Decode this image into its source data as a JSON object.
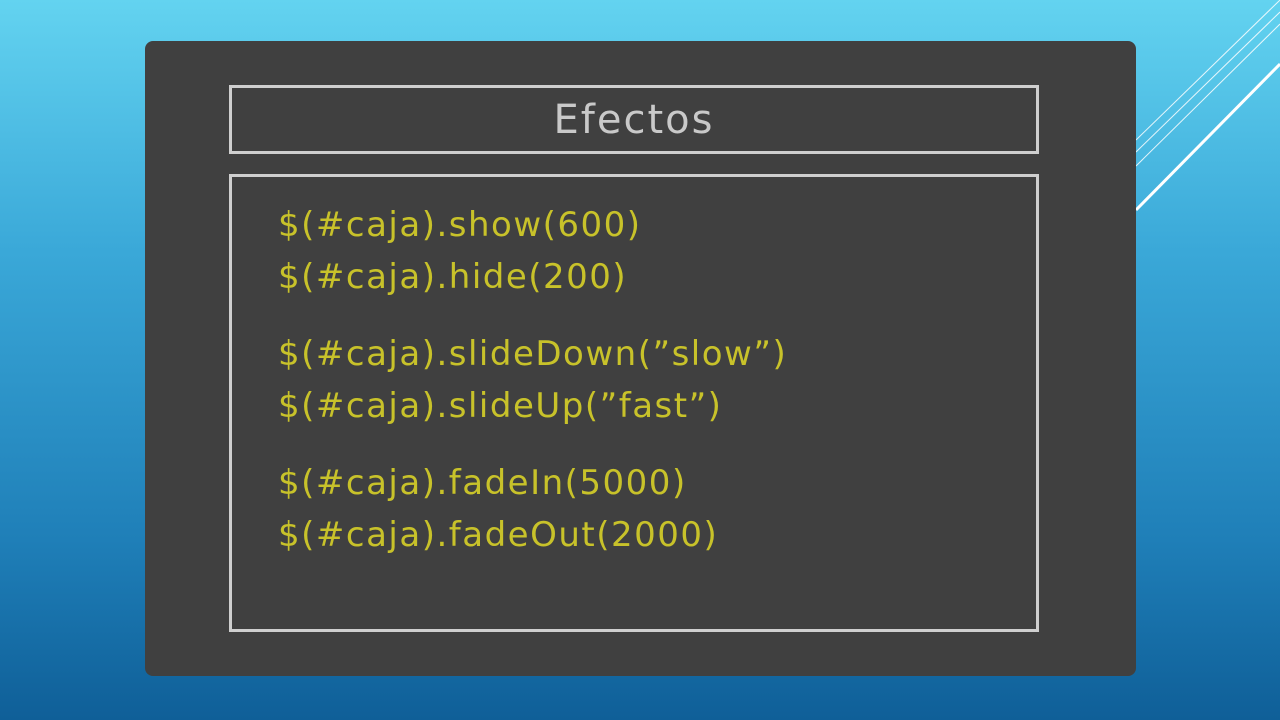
{
  "slide": {
    "title": "Efectos",
    "code_groups": [
      [
        "$(#caja).show(600)",
        "$(#caja).hide(200)"
      ],
      [
        "$(#caja).slideDown(”slow”)",
        "$(#caja).slideUp(”fast”)"
      ],
      [
        "$(#caja).fadeIn(5000)",
        "$(#caja).fadeOut(2000)"
      ]
    ]
  },
  "colors": {
    "background_top": "#63d3f0",
    "background_bottom": "#0f5f98",
    "board": "#404040",
    "border": "#cfcfcf",
    "title_text": "#c9c9c9",
    "code_text": "#c8c22a"
  }
}
